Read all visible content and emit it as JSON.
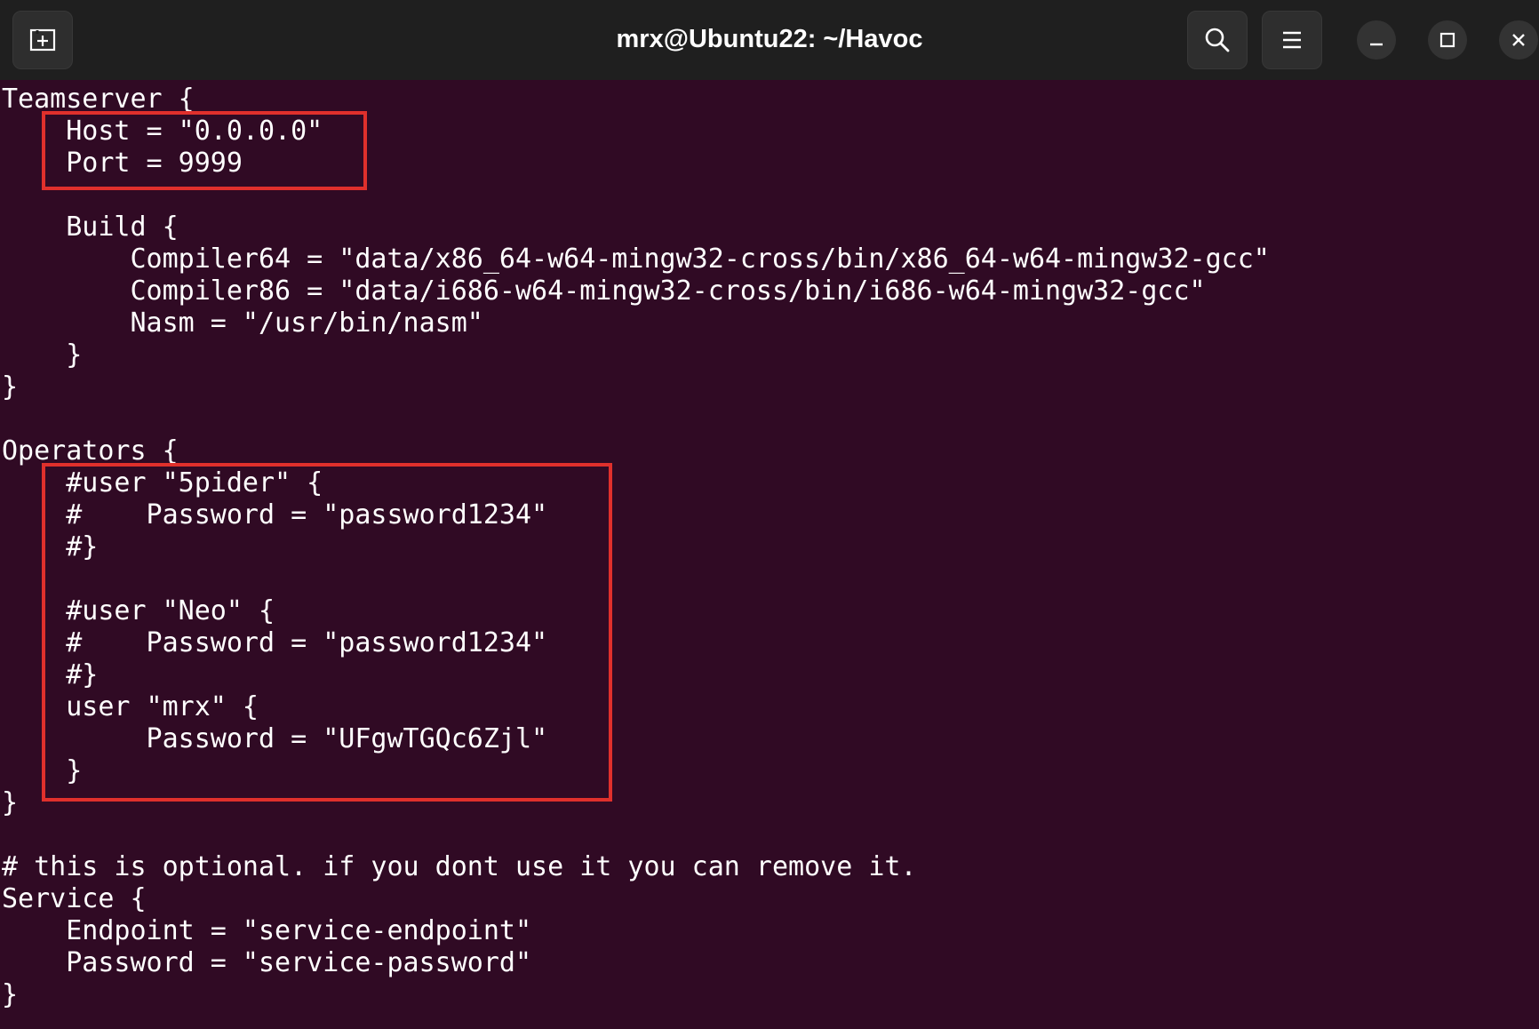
{
  "window": {
    "title": "mrx@Ubuntu22: ~/Havoc",
    "new_tab_icon": "new-tab-icon",
    "search_icon": "search-icon",
    "menu_icon": "hamburger-menu-icon",
    "minimize_icon": "minimize-icon",
    "maximize_icon": "maximize-icon",
    "close_icon": "close-icon"
  },
  "colors": {
    "terminal_bg": "#300a24",
    "titlebar_bg": "#1f1f1f",
    "highlight": "#e0302c",
    "text": "#ffffff"
  },
  "terminal": {
    "lines": [
      "Teamserver {",
      "    Host = \"0.0.0.0\"",
      "    Port = 9999",
      "",
      "    Build {",
      "        Compiler64 = \"data/x86_64-w64-mingw32-cross/bin/x86_64-w64-mingw32-gcc\"",
      "        Compiler86 = \"data/i686-w64-mingw32-cross/bin/i686-w64-mingw32-gcc\"",
      "        Nasm = \"/usr/bin/nasm\"",
      "    }",
      "}",
      "",
      "Operators {",
      "    #user \"5pider\" {",
      "    #    Password = \"password1234\"",
      "    #}",
      "",
      "    #user \"Neo\" {",
      "    #    Password = \"password1234\"",
      "    #}",
      "    user \"mrx\" {",
      "         Password = \"UFgwTGQc6Zjl\"",
      "    }",
      "}",
      "",
      "# this is optional. if you dont use it you can remove it.",
      "Service {",
      "    Endpoint = \"service-endpoint\"",
      "    Password = \"service-password\"",
      "}"
    ]
  }
}
